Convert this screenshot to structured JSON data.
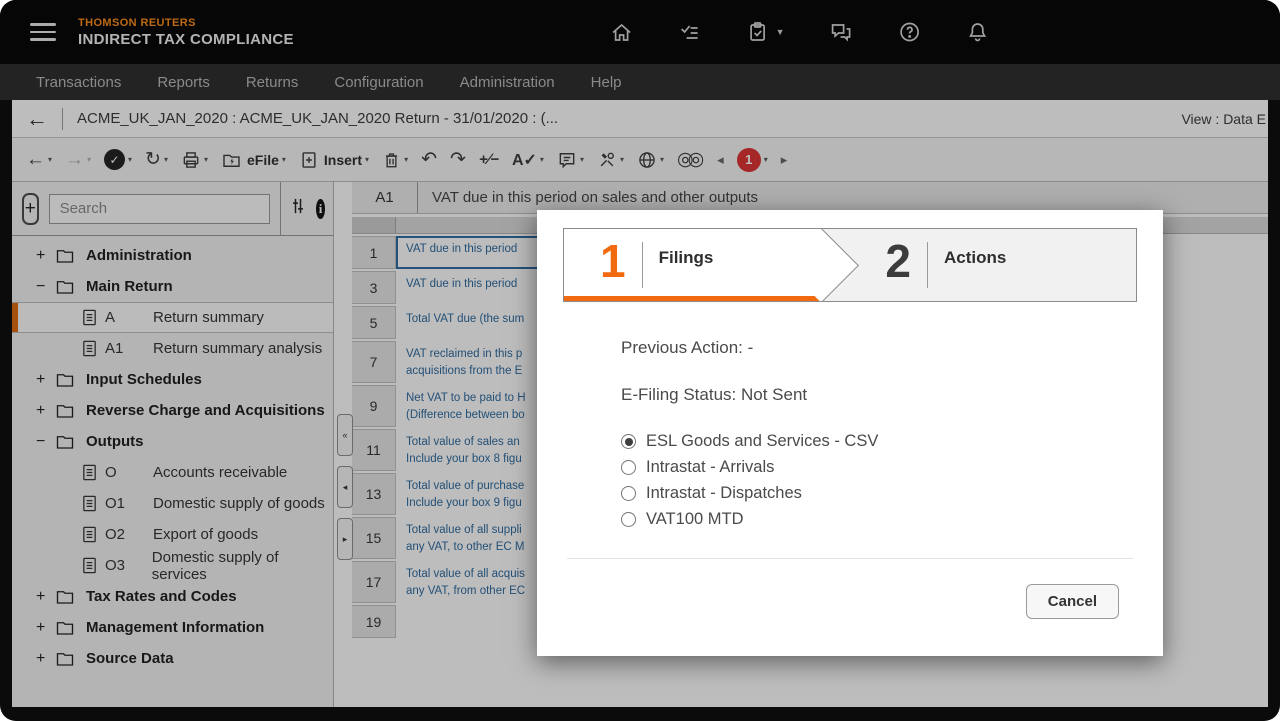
{
  "header": {
    "brand_line1": "THOMSON REUTERS",
    "brand_line2": "INDIRECT TAX COMPLIANCE",
    "icons": [
      "menu-icon",
      "home-icon",
      "checklist-icon",
      "clipboard-check-icon",
      "chat-icon",
      "help-icon",
      "bell-icon"
    ]
  },
  "menu": {
    "items": [
      "Transactions",
      "Reports",
      "Returns",
      "Configuration",
      "Administration",
      "Help"
    ]
  },
  "breadcrumb": {
    "title": "ACME_UK_JAN_2020 : ACME_UK_JAN_2020 Return - 31/01/2020 : (...",
    "view_label": "View : Data E"
  },
  "toolbar": {
    "icons": [
      "back-icon",
      "forward-icon",
      "check-circle-icon",
      "refresh-icon",
      "printer-icon",
      "efile-folder-icon",
      "insert-page-icon",
      "trash-icon",
      "undo-icon",
      "redo-icon",
      "plus-minus-icon",
      "font-check-icon",
      "comment-icon",
      "tools-icon",
      "globe-icon",
      "contrast-icon"
    ],
    "efile_label": "eFile",
    "insert_label": "Insert",
    "badge_count": "1"
  },
  "sidebar": {
    "add_button": "+",
    "search_placeholder": "Search",
    "tree": [
      {
        "expander": "+",
        "type": "folder",
        "label": "Administration"
      },
      {
        "expander": "−",
        "type": "folder",
        "label": "Main Return"
      },
      {
        "type": "doc",
        "code": "A",
        "label": "Return summary",
        "selected": true
      },
      {
        "type": "doc",
        "code": "A1",
        "label": "Return summary analysis"
      },
      {
        "expander": "+",
        "type": "folder",
        "label": "Input Schedules"
      },
      {
        "expander": "+",
        "type": "folder",
        "label": "Reverse Charge and Acquisitions"
      },
      {
        "expander": "−",
        "type": "folder",
        "label": "Outputs"
      },
      {
        "type": "doc",
        "code": "O",
        "label": "Accounts receivable"
      },
      {
        "type": "doc",
        "code": "O1",
        "label": "Domestic supply of goods"
      },
      {
        "type": "doc",
        "code": "O2",
        "label": "Export of goods"
      },
      {
        "type": "doc",
        "code": "O3",
        "label": "Domestic supply of services"
      },
      {
        "expander": "+",
        "type": "folder",
        "label": "Tax Rates and Codes"
      },
      {
        "expander": "+",
        "type": "folder",
        "label": "Management Information"
      },
      {
        "expander": "+",
        "type": "folder",
        "label": "Source Data"
      }
    ]
  },
  "grid": {
    "cell_ref": "A1",
    "formula_text": "VAT due in this period on sales and other outputs",
    "rows": [
      {
        "num": "1",
        "line1": "VAT due in this period",
        "line2": "",
        "selected": true
      },
      {
        "num": "3",
        "line1": "VAT due in this period",
        "line2": ""
      },
      {
        "num": "5",
        "line1": "Total VAT due (the sum",
        "line2": ""
      },
      {
        "num": "7",
        "line1": "VAT reclaimed in this p",
        "line2": "acquisitions from the E"
      },
      {
        "num": "9",
        "line1": "Net VAT to be paid to H",
        "line2": "(Difference between bo"
      },
      {
        "num": "11",
        "line1": "Total value of sales an",
        "line2": "Include your box 8 figu"
      },
      {
        "num": "13",
        "line1": "Total value of purchase",
        "line2": "Include your box 9 figu"
      },
      {
        "num": "15",
        "line1": "Total value of all suppli",
        "line2": "any VAT, to other EC M"
      },
      {
        "num": "17",
        "line1": "Total value of all acquis",
        "line2": "any VAT, from other EC"
      },
      {
        "num": "19",
        "line1": "",
        "line2": ""
      }
    ]
  },
  "modal": {
    "steps": [
      {
        "number": "1",
        "label": "Filings",
        "active": true
      },
      {
        "number": "2",
        "label": "Actions",
        "active": false
      }
    ],
    "previous_action": "Previous Action: -",
    "efiling_status": "E-Filing Status: Not Sent",
    "options": [
      {
        "label": "ESL Goods and Services - CSV",
        "selected": true
      },
      {
        "label": "Intrastat - Arrivals",
        "selected": false
      },
      {
        "label": "Intrastat - Dispatches",
        "selected": false
      },
      {
        "label": "VAT100 MTD",
        "selected": false
      }
    ],
    "cancel_label": "Cancel"
  },
  "colors": {
    "brand_orange": "#ff8c1a",
    "step_orange": "#f26a0f",
    "selected_bar_orange": "#e06a10",
    "grid_text_blue": "#2d6a9f",
    "badge_red": "#e03232",
    "header_black": "#050505",
    "menubar_grey": "#2d2d2d"
  }
}
